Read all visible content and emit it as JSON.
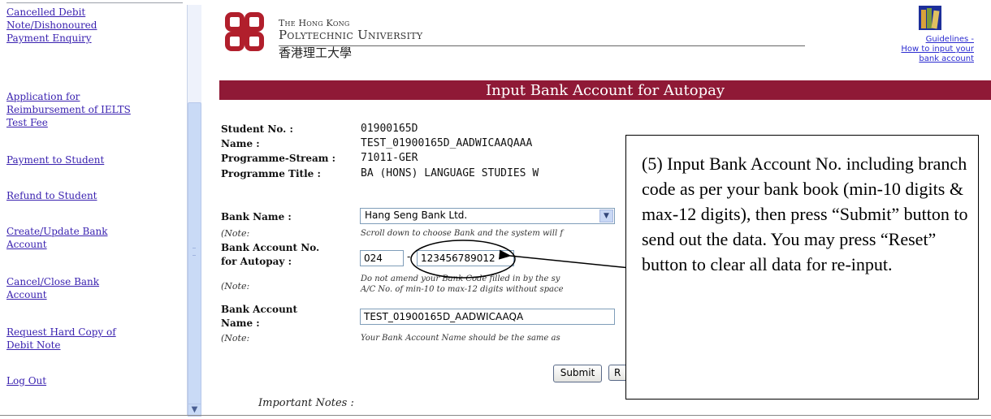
{
  "sidebar": {
    "items": [
      {
        "label_lines": [
          "Cancelled Debit",
          "Note/Dishonoured",
          "Payment Enquiry"
        ]
      },
      {
        "label_lines": [
          "Application for",
          "Reimbursement of IELTS",
          "Test Fee"
        ]
      },
      {
        "label_lines": [
          "Payment to Student"
        ]
      },
      {
        "label_lines": [
          "Refund to Student"
        ]
      },
      {
        "label_lines": [
          "Create/Update Bank",
          "Account"
        ]
      },
      {
        "label_lines": [
          "Cancel/Close Bank",
          "Account"
        ]
      },
      {
        "label_lines": [
          "Request Hard Copy of",
          "Debit Note"
        ]
      },
      {
        "label_lines": [
          "Log Out"
        ]
      }
    ]
  },
  "header": {
    "uni_small": "The Hong Kong",
    "uni_big": "Polytechnic University",
    "uni_zh": "香港理工大學",
    "guide_lines": [
      "Guidelines -",
      "How to input your",
      "bank account"
    ],
    "page_title": "Input Bank Account for Autopay"
  },
  "student": {
    "no_label": "Student No. :",
    "no_value": "01900165D",
    "name_label": "Name :",
    "name_value": "TEST_01900165D_AADWICAAQAAA",
    "stream_label": "Programme-Stream :",
    "stream_value": "71011-GER",
    "title_label": "Programme Title :",
    "title_value": "BA (HONS) LANGUAGE STUDIES W"
  },
  "form": {
    "bank_name_label": "Bank Name :",
    "bank_name_value": "Hang Seng Bank Ltd.",
    "note_label": "(Note:",
    "bank_name_note": "Scroll down to choose Bank and the system will f",
    "account_no_label_1": "Bank Account No.",
    "account_no_label_2": "for Autopay :",
    "bank_code_value": "024",
    "dash": "-",
    "account_no_value": "123456789012",
    "account_no_note_1": "Do not amend your Bank Code filled in by the sy",
    "account_no_note_2": "A/C No. of min-10 to max-12 digits without space",
    "account_name_label_1": "Bank Account",
    "account_name_label_2": "Name :",
    "account_name_value": "TEST_01900165D_AADWICAAQA",
    "account_name_note": "Your Bank Account Name should be the same as",
    "submit_label": "Submit",
    "reset_partial": "R",
    "important_notes": "Important Notes :"
  },
  "callout": {
    "text": "(5) Input Bank Account No. including branch code as per your bank book (min-10 digits & max-12 digits), then press “Submit” button to send out the data. You may press “Reset” button to clear all data for re-input."
  },
  "colors": {
    "title_bar": "#8f1936",
    "logo_red": "#b11f2c",
    "link": "#3a22b0"
  },
  "icons": {
    "logo": "polyu-logo-icon",
    "guide": "books-icon",
    "select_arrow": "chevron-down-icon",
    "scroll_down": "scroll-down-arrow-icon"
  }
}
